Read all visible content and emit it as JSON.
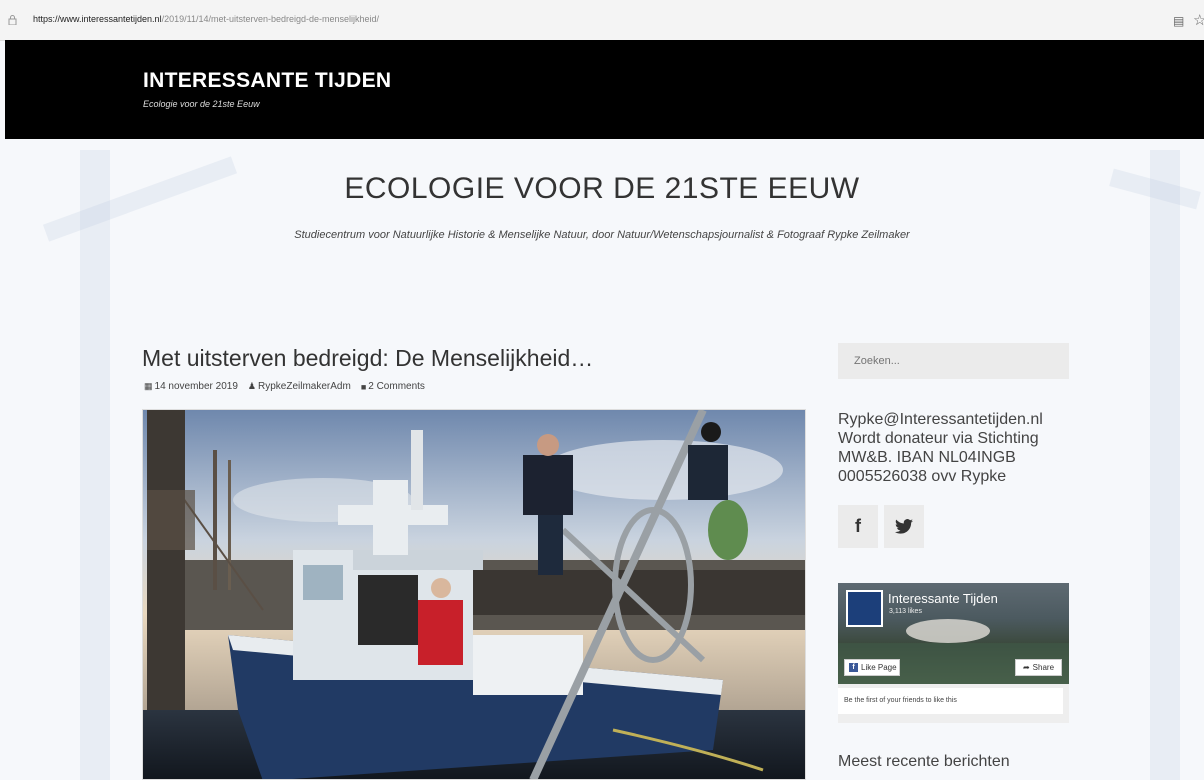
{
  "browser": {
    "url_host": "https://www.interessantetijden.nl",
    "url_path": "/2019/11/14/met-uitsterven-bedreigd-de-menselijkheid/"
  },
  "header": {
    "site_title": "INTERESSANTE TIJDEN",
    "tagline": "Ecologie voor de 21ste Eeuw"
  },
  "hero": {
    "title": "ECOLOGIE VOOR DE 21STE EEUW",
    "subtitle": "Studiecentrum voor Natuurlijke Historie & Menselijke Natuur, door Natuur/Wetenschapsjournalist & Fotograaf Rypke Zeilmaker"
  },
  "post": {
    "title": "Met uitsterven bedreigd: De Menselijkheid…",
    "date": "14 november 2019",
    "author": "RypkeZeilmakerAdm",
    "comments": "2 Comments"
  },
  "sidebar": {
    "search_placeholder": "Zoeken...",
    "contact_lines": [
      "Rypke@Interessantetijden.nl",
      "Wordt donateur via Stichting",
      "MW&B. IBAN NL04INGB",
      "0005526038 ovv Rypke"
    ],
    "social": {
      "facebook": "f",
      "twitter": "❦"
    },
    "fb_widget": {
      "page_name": "Interessante Tijden",
      "likes": "3,113 likes",
      "like_label": "Like Page",
      "share_label": "Share",
      "friends_text": "Be the first of your friends to like this"
    },
    "recent_heading": "Meest recente berichten"
  },
  "colors": {
    "header_bg": "#000000",
    "page_bg": "#f6f8fb",
    "fb_blue": "#3b5998"
  }
}
